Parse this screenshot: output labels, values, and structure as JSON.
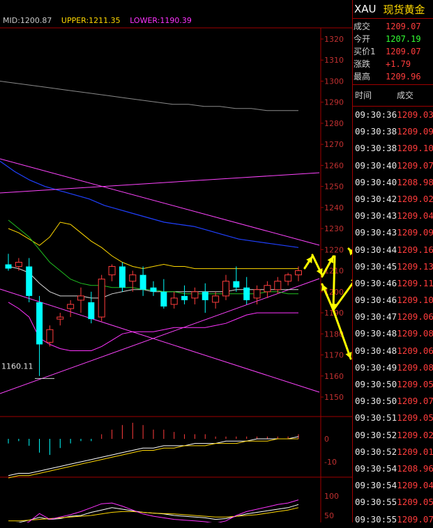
{
  "indicators": {
    "mid": "MID:1200.87",
    "upper": "UPPER:1211.35",
    "lower": "LOWER:1190.39",
    "mid_color": "#c8c8c8",
    "upper_color": "#ffd800",
    "lower_color": "#ff33ff"
  },
  "price_axis": [
    "1320",
    "1310",
    "1300",
    "1290",
    "1280",
    "1270",
    "1260",
    "1250",
    "1240",
    "1230",
    "1220",
    "1210",
    "1200",
    "1190",
    "1180",
    "1170",
    "1160",
    "1150"
  ],
  "low_annotation": "1160.11",
  "macd_axis": [
    "0",
    "-10"
  ],
  "kdj_axis": [
    "100",
    "50"
  ],
  "panel": {
    "symbol": "XAU",
    "name": "现货黄金",
    "quote": [
      {
        "label": "成交",
        "value": "1209.07",
        "color": "#ff3c3c"
      },
      {
        "label": "今开",
        "value": "1207.19",
        "color": "#33ff33"
      },
      {
        "label": "买价1",
        "value": "1209.07",
        "color": "#ff3c3c"
      },
      {
        "label": "涨跌",
        "value": "+1.79",
        "color": "#ff3c3c"
      },
      {
        "label": "最高",
        "value": "1209.96",
        "color": "#ff3c3c"
      }
    ],
    "col_time": "时间",
    "col_price": "成交",
    "ticks": [
      {
        "t": "09:30:36",
        "p": "1209.03"
      },
      {
        "t": "09:30:38",
        "p": "1209.09"
      },
      {
        "t": "09:30:38",
        "p": "1209.10"
      },
      {
        "t": "09:30:40",
        "p": "1209.07"
      },
      {
        "t": "09:30:40",
        "p": "1208.98"
      },
      {
        "t": "09:30:42",
        "p": "1209.02"
      },
      {
        "t": "09:30:43",
        "p": "1209.04"
      },
      {
        "t": "09:30:43",
        "p": "1209.09"
      },
      {
        "t": "09:30:44",
        "p": "1209.16"
      },
      {
        "t": "09:30:45",
        "p": "1209.13"
      },
      {
        "t": "09:30:46",
        "p": "1209.11"
      },
      {
        "t": "09:30:46",
        "p": "1209.10"
      },
      {
        "t": "09:30:47",
        "p": "1209.06"
      },
      {
        "t": "09:30:48",
        "p": "1209.08"
      },
      {
        "t": "09:30:48",
        "p": "1209.06"
      },
      {
        "t": "09:30:49",
        "p": "1209.08"
      },
      {
        "t": "09:30:50",
        "p": "1209.05"
      },
      {
        "t": "09:30:50",
        "p": "1209.07"
      },
      {
        "t": "09:30:51",
        "p": "1209.05"
      },
      {
        "t": "09:30:52",
        "p": "1209.02"
      },
      {
        "t": "09:30:52",
        "p": "1209.01"
      },
      {
        "t": "09:30:54",
        "p": "1208.96"
      },
      {
        "t": "09:30:54",
        "p": "1209.04"
      },
      {
        "t": "09:30:55",
        "p": "1209.05"
      },
      {
        "t": "09:30:55",
        "p": "1209.07"
      }
    ]
  },
  "chart_data": {
    "type": "candlestick",
    "price_range": [
      1150,
      1325
    ],
    "candles": [
      {
        "o": 1213,
        "h": 1218,
        "l": 1210,
        "c": 1211
      },
      {
        "o": 1212,
        "h": 1216,
        "l": 1210,
        "c": 1214
      },
      {
        "o": 1212,
        "h": 1216,
        "l": 1195,
        "c": 1198
      },
      {
        "o": 1195,
        "h": 1198,
        "l": 1160,
        "c": 1175
      },
      {
        "o": 1176,
        "h": 1184,
        "l": 1174,
        "c": 1182
      },
      {
        "o": 1187,
        "h": 1190,
        "l": 1184,
        "c": 1188
      },
      {
        "o": 1192,
        "h": 1196,
        "l": 1188,
        "c": 1194
      },
      {
        "o": 1196,
        "h": 1202,
        "l": 1190,
        "c": 1198
      },
      {
        "o": 1195,
        "h": 1200,
        "l": 1185,
        "c": 1187
      },
      {
        "o": 1188,
        "h": 1208,
        "l": 1186,
        "c": 1206
      },
      {
        "o": 1208,
        "h": 1213,
        "l": 1205,
        "c": 1212
      },
      {
        "o": 1212,
        "h": 1214,
        "l": 1200,
        "c": 1202
      },
      {
        "o": 1205,
        "h": 1210,
        "l": 1200,
        "c": 1208
      },
      {
        "o": 1208,
        "h": 1212,
        "l": 1198,
        "c": 1201
      },
      {
        "o": 1202,
        "h": 1205,
        "l": 1198,
        "c": 1200
      },
      {
        "o": 1200,
        "h": 1206,
        "l": 1192,
        "c": 1193
      },
      {
        "o": 1194,
        "h": 1200,
        "l": 1192,
        "c": 1197
      },
      {
        "o": 1198,
        "h": 1203,
        "l": 1194,
        "c": 1196
      },
      {
        "o": 1197,
        "h": 1202,
        "l": 1194,
        "c": 1200
      },
      {
        "o": 1200,
        "h": 1204,
        "l": 1190,
        "c": 1196
      },
      {
        "o": 1195,
        "h": 1200,
        "l": 1192,
        "c": 1198
      },
      {
        "o": 1198,
        "h": 1208,
        "l": 1196,
        "c": 1205
      },
      {
        "o": 1205,
        "h": 1212,
        "l": 1200,
        "c": 1202
      },
      {
        "o": 1202,
        "h": 1207,
        "l": 1194,
        "c": 1196
      },
      {
        "o": 1197,
        "h": 1203,
        "l": 1194,
        "c": 1201
      },
      {
        "o": 1200,
        "h": 1205,
        "l": 1197,
        "c": 1203
      },
      {
        "o": 1201,
        "h": 1207,
        "l": 1199,
        "c": 1205
      },
      {
        "o": 1205,
        "h": 1209,
        "l": 1203,
        "c": 1208
      },
      {
        "o": 1208,
        "h": 1212,
        "l": 1205,
        "c": 1210
      }
    ],
    "upper_band": [
      1230,
      1228,
      1225,
      1222,
      1226,
      1233,
      1232,
      1228,
      1224,
      1221,
      1217,
      1214,
      1212,
      1211,
      1212,
      1213,
      1212,
      1212,
      1211,
      1211,
      1211,
      1211,
      1211,
      1211,
      1211,
      1211,
      1211,
      1211,
      1211
    ],
    "mid_band": [
      1212,
      1211,
      1209,
      1204,
      1200,
      1198,
      1198,
      1198,
      1197,
      1197,
      1199,
      1200,
      1201,
      1201,
      1200,
      1200,
      1200,
      1200,
      1200,
      1200,
      1200,
      1200,
      1201,
      1201,
      1201,
      1201,
      1201,
      1201,
      1201
    ],
    "lower_band": [
      1195,
      1192,
      1188,
      1178,
      1175,
      1173,
      1172,
      1172,
      1172,
      1174,
      1177,
      1180,
      1181,
      1181,
      1181,
      1182,
      1183,
      1183,
      1183,
      1183,
      1184,
      1185,
      1187,
      1189,
      1190,
      1190,
      1190,
      1190,
      1190
    ],
    "ma_green": [
      1234,
      1230,
      1226,
      1220,
      1214,
      1210,
      1206,
      1204,
      1203,
      1203,
      1202,
      1202,
      1202,
      1201,
      1201,
      1200,
      1200,
      1199,
      1199,
      1199,
      1199,
      1199,
      1199,
      1199,
      1199,
      1200,
      1200,
      1199,
      1199
    ],
    "ma_blue": [
      1262,
      1257,
      1253,
      1250,
      1248,
      1246,
      1244,
      1241,
      1239,
      1237,
      1235,
      1233,
      1232,
      1231,
      1229,
      1227,
      1225,
      1224,
      1223,
      1222,
      1221
    ],
    "ma_white": [
      1300,
      1299,
      1298,
      1297,
      1296,
      1295,
      1294,
      1293,
      1292,
      1291,
      1290,
      1289,
      1289,
      1288,
      1288,
      1287,
      1287,
      1286,
      1286,
      1286
    ],
    "macd_hist": [
      -2,
      -1,
      -3,
      -6,
      -7,
      -4,
      -2,
      -1,
      -1,
      2,
      4,
      6,
      7,
      6,
      4,
      4,
      3,
      2,
      2,
      2,
      1,
      1,
      1,
      1,
      1,
      1,
      1,
      1,
      2
    ],
    "macd_dif": [
      -16,
      -15,
      -15,
      -14,
      -13,
      -12,
      -11,
      -10,
      -9,
      -8,
      -7,
      -6,
      -5,
      -4,
      -4,
      -3,
      -3,
      -3,
      -2,
      -2,
      -2,
      -1,
      -1,
      -1,
      0,
      0,
      0,
      0,
      1
    ],
    "macd_dea": [
      -17,
      -16,
      -16,
      -15,
      -14,
      -13,
      -12,
      -11,
      -10,
      -9,
      -8,
      -7,
      -6,
      -5,
      -5,
      -4,
      -4,
      -3,
      -3,
      -3,
      -2,
      -2,
      -2,
      -1,
      -1,
      -1,
      0,
      0,
      0
    ],
    "kdj_k": [
      30,
      32,
      38,
      45,
      40,
      42,
      48,
      50,
      58,
      64,
      70,
      66,
      62,
      58,
      56,
      54,
      50,
      48,
      46,
      44,
      40,
      42,
      48,
      54,
      58,
      62,
      66,
      70,
      78
    ],
    "kdj_d": [
      36,
      36,
      38,
      40,
      42,
      44,
      46,
      48,
      50,
      54,
      58,
      60,
      60,
      58,
      56,
      55,
      54,
      52,
      50,
      48,
      46,
      46,
      48,
      50,
      52,
      56,
      60,
      64,
      70
    ],
    "kdj_j": [
      20,
      24,
      34,
      55,
      40,
      46,
      52,
      60,
      70,
      80,
      82,
      74,
      64,
      54,
      48,
      44,
      40,
      38,
      36,
      34,
      30,
      36,
      50,
      60,
      66,
      72,
      78,
      82,
      90
    ]
  }
}
